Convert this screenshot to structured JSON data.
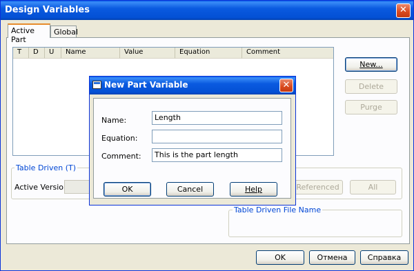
{
  "window": {
    "title": "Design Variables"
  },
  "tabs": [
    {
      "label": "Active Part"
    },
    {
      "label": "Global"
    }
  ],
  "list": {
    "columns": [
      "T",
      "D",
      "U",
      "Name",
      "Value",
      "Equation",
      "Comment"
    ]
  },
  "side_buttons": {
    "new": "New...",
    "delete": "Delete",
    "purge": "Purge"
  },
  "table_driven": {
    "title": "Table Driven (T)",
    "active_version_label": "Active Version:",
    "active_version_value": "",
    "referenced": "Referenced",
    "all": "All",
    "file_group_title": "Table Driven File Name"
  },
  "footer": {
    "ok": "OK",
    "cancel": "Отмена",
    "help": "Справка"
  },
  "dialog": {
    "title": "New Part Variable",
    "name_label": "Name:",
    "name_value": "Length",
    "equation_label": "Equation:",
    "equation_value": "",
    "comment_label": "Comment:",
    "comment_value": "This is the part length",
    "ok": "OK",
    "cancel": "Cancel",
    "help": "Help"
  }
}
